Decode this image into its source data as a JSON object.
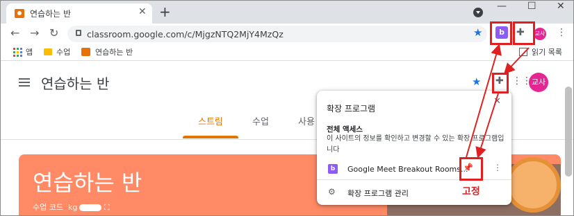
{
  "tab": {
    "title": "연습하는 반",
    "close": "✕"
  },
  "newtab": "+",
  "window": {
    "minimize": "—",
    "maximize": "☐",
    "close": "✕"
  },
  "nav": {
    "back": "←",
    "forward": "→",
    "reload": "↻"
  },
  "omnibox": {
    "url": "classroom.google.com/c/MjgzNTQ2MjY4MzQz"
  },
  "ext_button_label": "b",
  "profile_initials": "교사",
  "bookmarks": {
    "apps": "앱",
    "folder": "수업",
    "class": "연습하는 반",
    "reading_list": "읽기 목록"
  },
  "page": {
    "class_name": "연습하는 반",
    "tabs": [
      "스트림",
      "수업",
      "사용"
    ],
    "banner_title": "연습하는 반",
    "class_code_label": "수업 코드",
    "class_code_partial": "kg",
    "avatar": "교사"
  },
  "popup": {
    "title": "확장 프로그램",
    "section": "전체 액세스",
    "description": "이 사이트의 정보를 확인하고 변경할 수 있는 확장 프로그램입니다",
    "extension_name": "Google Meet Breakout Rooms...",
    "manage": "확장 프로그램 관리"
  },
  "annotation": {
    "pin_label": "고정"
  },
  "colors": {
    "accent": "#e37400",
    "annotation": "#e02020",
    "extension": "#8b5cf6",
    "banner": "#ff8a65"
  }
}
